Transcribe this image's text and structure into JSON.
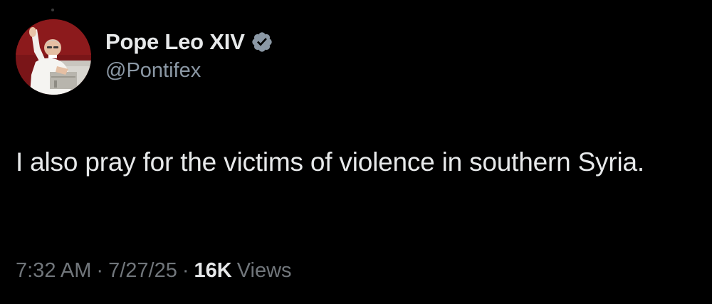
{
  "author": {
    "display_name": "Pope Leo XIV",
    "handle": "@Pontifex",
    "verified_icon": "verified-badge-icon",
    "avatar_icon": "profile-photo",
    "badge_color": "#8b98a5"
  },
  "tweet": {
    "text": "I also pray for the victims of violence in southern Syria."
  },
  "meta": {
    "time": "7:32 AM",
    "separator": "·",
    "date": "7/27/25",
    "views_count": "16K",
    "views_label": "Views"
  },
  "colors": {
    "background": "#000000",
    "primary_text": "#e7e9ea",
    "secondary_text": "#71767b",
    "handle_text": "#8b98a5"
  }
}
